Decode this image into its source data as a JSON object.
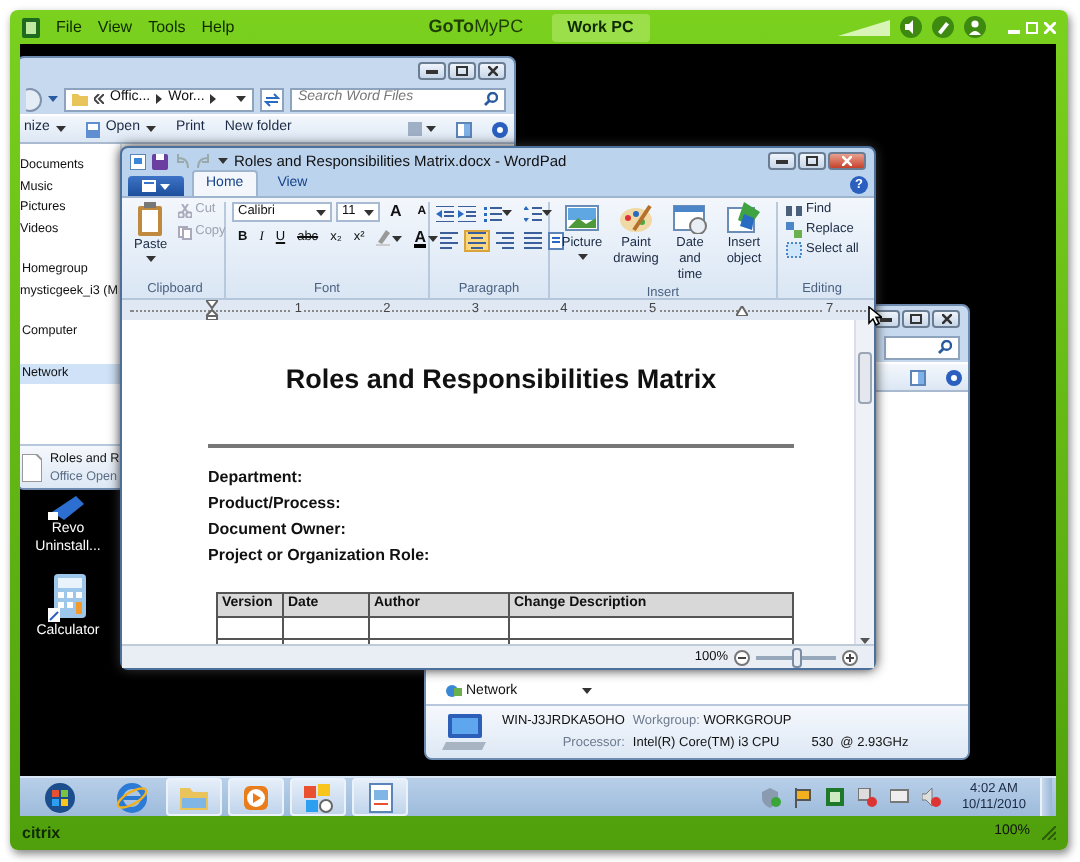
{
  "app_bar": {
    "menu": [
      "File",
      "View",
      "Tools",
      "Help"
    ],
    "brand": "**GoTo**MyPC",
    "session_tab": "Work PC"
  },
  "explorer_back": {
    "breadcrumbs": [
      "Offic...",
      "Wor..."
    ],
    "search": {
      "placeholder": "Search Word Files"
    },
    "toolbar": [
      {
        "label": "nize",
        "kind": "menu"
      },
      {
        "label": "Open",
        "kind": "open"
      },
      {
        "label": "Print",
        "kind": "plain"
      },
      {
        "label": "New folder",
        "kind": "plain"
      }
    ],
    "nav": [
      {
        "children": [
          {
            "label": "Documents",
            "selected": false
          },
          {
            "label": "Music",
            "selected": false
          },
          {
            "label": "Pictures",
            "selected": false
          },
          {
            "label": "Videos",
            "selected": false
          }
        ]
      },
      {
        "label": "Homegroup",
        "selected": false,
        "children": [
          {
            "label": "mysticgeek_i3 (M",
            "selected": false
          }
        ]
      },
      {
        "label": "Computer",
        "selected": false
      },
      {
        "label": "Network",
        "selected": true
      }
    ],
    "details": {
      "name": "Roles and R",
      "type": "Office Open"
    }
  },
  "desktop_icons": [
    {
      "kind": "uninstaller",
      "label": "Revo Uninstall..."
    },
    {
      "kind": "calculator",
      "label": "Calculator"
    }
  ],
  "wordpad": {
    "title": "Roles and Responsibilities Matrix.docx - WordPad",
    "tabs": [
      {
        "label": "Home",
        "selected": true
      },
      {
        "label": "View",
        "selected": false
      }
    ],
    "help": "?",
    "clipboard": {
      "label": "Clipboard",
      "paste": "Paste",
      "items": [
        {
          "label": "Cut",
          "kind": "cut",
          "disabled": true
        },
        {
          "label": "Copy",
          "kind": "copy",
          "disabled": true
        }
      ]
    },
    "font": {
      "label": "Font",
      "name": "Calibri",
      "size": "11",
      "grow": "A",
      "shrink": "A",
      "format_buttons": [
        "B",
        "I",
        "U",
        "abc",
        "x₂",
        "x²"
      ],
      "color_button": "A"
    },
    "paragraph": {
      "label": "Paragraph",
      "alignment": [
        {
          "kind": "left",
          "selected": false
        },
        {
          "kind": "center",
          "selected": true
        },
        {
          "kind": "right",
          "selected": false
        },
        {
          "kind": "justify",
          "selected": false
        }
      ]
    },
    "insert": {
      "label": "Insert",
      "items": [
        {
          "label": "Picture",
          "kind": "picture"
        },
        {
          "label": "Paint drawing",
          "kind": "paint"
        },
        {
          "label": "Date and time",
          "kind": "datetime"
        },
        {
          "label": "Insert object",
          "kind": "object"
        }
      ]
    },
    "editing": {
      "label": "Editing",
      "items": [
        {
          "label": "Find",
          "kind": "find"
        },
        {
          "label": "Replace",
          "kind": "replace"
        },
        {
          "label": "Select all",
          "kind": "select"
        }
      ]
    },
    "ruler": [
      {
        "label": "1"
      },
      {
        "label": "2"
      },
      {
        "label": "3"
      },
      {
        "label": "4"
      },
      {
        "label": "5"
      },
      {
        "kind": "indent-marker"
      },
      {
        "label": "7"
      }
    ],
    "document": {
      "title": "Roles and Responsibilities Matrix",
      "fields": [
        "Department:",
        "Product/Process:",
        "Document Owner:",
        "Project or Organization Role:"
      ],
      "table": {
        "columns": [
          "Version",
          "Date",
          "Author",
          "Change Description"
        ],
        "rows": [
          {
            "kind": "blank"
          },
          {
            "kind": "blank"
          }
        ]
      }
    },
    "status": {
      "zoom": "100%",
      "level": 0.5
    }
  },
  "explorer_front": {
    "nav_item": "Network",
    "computer_name": "WIN-J3JRDKA5OHO",
    "workgroup_label": "Workgroup:",
    "workgroup": "WORKGROUP",
    "processor_label": "Processor:",
    "processor": "Intel(R) Core(TM) i3 CPU",
    "processor_speed": "530  @ 2.93GHz"
  },
  "taskbar": {
    "apps": [
      {
        "kind": "start",
        "running": false
      },
      {
        "kind": "browser",
        "running": false
      },
      {
        "kind": "folder",
        "running": true
      },
      {
        "kind": "media",
        "running": true
      },
      {
        "kind": "app",
        "running": true
      },
      {
        "kind": "document",
        "running": true
      }
    ],
    "time": "4:02 AM",
    "date": "10/11/2010"
  },
  "footer": {
    "brand": "citrix",
    "zoom": "100%"
  }
}
